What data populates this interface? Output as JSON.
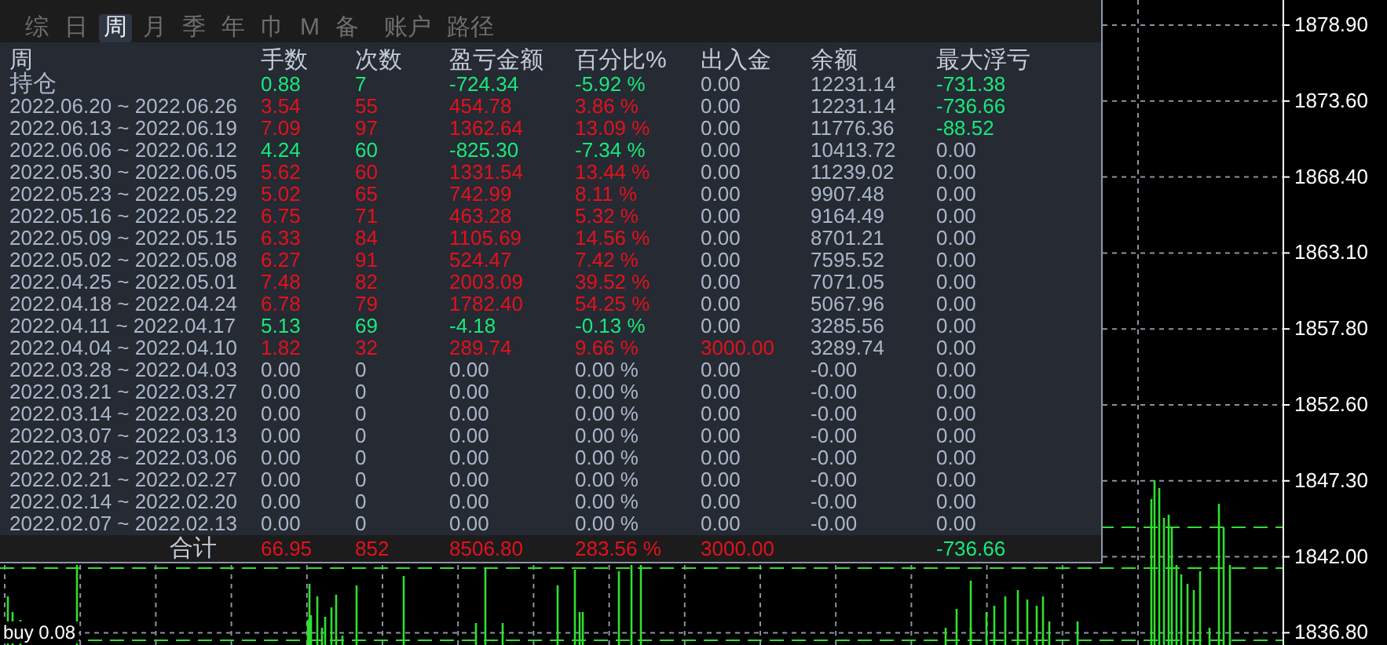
{
  "tabs": [
    {
      "label": "综",
      "selected": false
    },
    {
      "label": "日",
      "selected": false
    },
    {
      "label": "周",
      "selected": true
    },
    {
      "label": "月",
      "selected": false
    },
    {
      "label": "季",
      "selected": false
    },
    {
      "label": "年",
      "selected": false
    },
    {
      "label": "巾",
      "selected": false
    },
    {
      "label": "M",
      "selected": false
    },
    {
      "label": "备",
      "selected": false
    },
    {
      "label": "账户",
      "selected": false
    },
    {
      "label": "路径",
      "selected": false
    }
  ],
  "table": {
    "columns": [
      "周",
      "手数",
      "次数",
      "盈亏金额",
      "百分比%",
      "出入金",
      "余额",
      "最大浮亏"
    ],
    "rows": [
      [
        {
          "text": "持仓",
          "color": "#aab6c8"
        },
        {
          "text": "0.88",
          "color": "#19e87a"
        },
        {
          "text": "7",
          "color": "#19e87a"
        },
        {
          "text": "-724.34",
          "color": "#19e87a"
        },
        {
          "text": "-5.92 %",
          "color": "#19e87a"
        },
        {
          "text": "0.00",
          "color": "#aab6c8"
        },
        {
          "text": "12231.14",
          "color": "#aab6c8"
        },
        {
          "text": "-731.38",
          "color": "#19e87a"
        }
      ],
      [
        {
          "text": "2022.06.20 ~ 2022.06.26",
          "color": "#aab6c8"
        },
        {
          "text": "3.54",
          "color": "#e3121c"
        },
        {
          "text": "55",
          "color": "#e3121c"
        },
        {
          "text": "454.78",
          "color": "#e3121c"
        },
        {
          "text": "3.86 %",
          "color": "#e3121c"
        },
        {
          "text": "0.00",
          "color": "#aab6c8"
        },
        {
          "text": "12231.14",
          "color": "#aab6c8"
        },
        {
          "text": "-736.66",
          "color": "#19e87a"
        }
      ],
      [
        {
          "text": "2022.06.13 ~ 2022.06.19",
          "color": "#aab6c8"
        },
        {
          "text": "7.09",
          "color": "#e3121c"
        },
        {
          "text": "97",
          "color": "#e3121c"
        },
        {
          "text": "1362.64",
          "color": "#e3121c"
        },
        {
          "text": "13.09 %",
          "color": "#e3121c"
        },
        {
          "text": "0.00",
          "color": "#aab6c8"
        },
        {
          "text": "11776.36",
          "color": "#aab6c8"
        },
        {
          "text": "-88.52",
          "color": "#19e87a"
        }
      ],
      [
        {
          "text": "2022.06.06 ~ 2022.06.12",
          "color": "#aab6c8"
        },
        {
          "text": "4.24",
          "color": "#19e87a"
        },
        {
          "text": "60",
          "color": "#19e87a"
        },
        {
          "text": "-825.30",
          "color": "#19e87a"
        },
        {
          "text": "-7.34 %",
          "color": "#19e87a"
        },
        {
          "text": "0.00",
          "color": "#aab6c8"
        },
        {
          "text": "10413.72",
          "color": "#aab6c8"
        },
        {
          "text": "0.00",
          "color": "#aab6c8"
        }
      ],
      [
        {
          "text": "2022.05.30 ~ 2022.06.05",
          "color": "#aab6c8"
        },
        {
          "text": "5.62",
          "color": "#e3121c"
        },
        {
          "text": "60",
          "color": "#e3121c"
        },
        {
          "text": "1331.54",
          "color": "#e3121c"
        },
        {
          "text": "13.44 %",
          "color": "#e3121c"
        },
        {
          "text": "0.00",
          "color": "#aab6c8"
        },
        {
          "text": "11239.02",
          "color": "#aab6c8"
        },
        {
          "text": "0.00",
          "color": "#aab6c8"
        }
      ],
      [
        {
          "text": "2022.05.23 ~ 2022.05.29",
          "color": "#aab6c8"
        },
        {
          "text": "5.02",
          "color": "#e3121c"
        },
        {
          "text": "65",
          "color": "#e3121c"
        },
        {
          "text": "742.99",
          "color": "#e3121c"
        },
        {
          "text": "8.11 %",
          "color": "#e3121c"
        },
        {
          "text": "0.00",
          "color": "#aab6c8"
        },
        {
          "text": "9907.48",
          "color": "#aab6c8"
        },
        {
          "text": "0.00",
          "color": "#aab6c8"
        }
      ],
      [
        {
          "text": "2022.05.16 ~ 2022.05.22",
          "color": "#aab6c8"
        },
        {
          "text": "6.75",
          "color": "#e3121c"
        },
        {
          "text": "71",
          "color": "#e3121c"
        },
        {
          "text": "463.28",
          "color": "#e3121c"
        },
        {
          "text": "5.32 %",
          "color": "#e3121c"
        },
        {
          "text": "0.00",
          "color": "#aab6c8"
        },
        {
          "text": "9164.49",
          "color": "#aab6c8"
        },
        {
          "text": "0.00",
          "color": "#aab6c8"
        }
      ],
      [
        {
          "text": "2022.05.09 ~ 2022.05.15",
          "color": "#aab6c8"
        },
        {
          "text": "6.33",
          "color": "#e3121c"
        },
        {
          "text": "84",
          "color": "#e3121c"
        },
        {
          "text": "1105.69",
          "color": "#e3121c"
        },
        {
          "text": "14.56 %",
          "color": "#e3121c"
        },
        {
          "text": "0.00",
          "color": "#aab6c8"
        },
        {
          "text": "8701.21",
          "color": "#aab6c8"
        },
        {
          "text": "0.00",
          "color": "#aab6c8"
        }
      ],
      [
        {
          "text": "2022.05.02 ~ 2022.05.08",
          "color": "#aab6c8"
        },
        {
          "text": "6.27",
          "color": "#e3121c"
        },
        {
          "text": "91",
          "color": "#e3121c"
        },
        {
          "text": "524.47",
          "color": "#e3121c"
        },
        {
          "text": "7.42 %",
          "color": "#e3121c"
        },
        {
          "text": "0.00",
          "color": "#aab6c8"
        },
        {
          "text": "7595.52",
          "color": "#aab6c8"
        },
        {
          "text": "0.00",
          "color": "#aab6c8"
        }
      ],
      [
        {
          "text": "2022.04.25 ~ 2022.05.01",
          "color": "#aab6c8"
        },
        {
          "text": "7.48",
          "color": "#e3121c"
        },
        {
          "text": "82",
          "color": "#e3121c"
        },
        {
          "text": "2003.09",
          "color": "#e3121c"
        },
        {
          "text": "39.52 %",
          "color": "#e3121c"
        },
        {
          "text": "0.00",
          "color": "#aab6c8"
        },
        {
          "text": "7071.05",
          "color": "#aab6c8"
        },
        {
          "text": "0.00",
          "color": "#aab6c8"
        }
      ],
      [
        {
          "text": "2022.04.18 ~ 2022.04.24",
          "color": "#aab6c8"
        },
        {
          "text": "6.78",
          "color": "#e3121c"
        },
        {
          "text": "79",
          "color": "#e3121c"
        },
        {
          "text": "1782.40",
          "color": "#e3121c"
        },
        {
          "text": "54.25 %",
          "color": "#e3121c"
        },
        {
          "text": "0.00",
          "color": "#aab6c8"
        },
        {
          "text": "5067.96",
          "color": "#aab6c8"
        },
        {
          "text": "0.00",
          "color": "#aab6c8"
        }
      ],
      [
        {
          "text": "2022.04.11 ~ 2022.04.17",
          "color": "#aab6c8"
        },
        {
          "text": "5.13",
          "color": "#19e87a"
        },
        {
          "text": "69",
          "color": "#19e87a"
        },
        {
          "text": "-4.18",
          "color": "#19e87a"
        },
        {
          "text": "-0.13 %",
          "color": "#19e87a"
        },
        {
          "text": "0.00",
          "color": "#aab6c8"
        },
        {
          "text": "3285.56",
          "color": "#aab6c8"
        },
        {
          "text": "0.00",
          "color": "#aab6c8"
        }
      ],
      [
        {
          "text": "2022.04.04 ~ 2022.04.10",
          "color": "#aab6c8"
        },
        {
          "text": "1.82",
          "color": "#e3121c"
        },
        {
          "text": "32",
          "color": "#e3121c"
        },
        {
          "text": "289.74",
          "color": "#e3121c"
        },
        {
          "text": "9.66 %",
          "color": "#e3121c"
        },
        {
          "text": "3000.00",
          "color": "#e3121c"
        },
        {
          "text": "3289.74",
          "color": "#aab6c8"
        },
        {
          "text": "0.00",
          "color": "#aab6c8"
        }
      ],
      [
        {
          "text": "2022.03.28 ~ 2022.04.03",
          "color": "#aab6c8"
        },
        {
          "text": "0.00",
          "color": "#aab6c8"
        },
        {
          "text": "0",
          "color": "#aab6c8"
        },
        {
          "text": "0.00",
          "color": "#aab6c8"
        },
        {
          "text": "0.00 %",
          "color": "#aab6c8"
        },
        {
          "text": "0.00",
          "color": "#aab6c8"
        },
        {
          "text": "-0.00",
          "color": "#aab6c8"
        },
        {
          "text": "0.00",
          "color": "#aab6c8"
        }
      ],
      [
        {
          "text": "2022.03.21 ~ 2022.03.27",
          "color": "#aab6c8"
        },
        {
          "text": "0.00",
          "color": "#aab6c8"
        },
        {
          "text": "0",
          "color": "#aab6c8"
        },
        {
          "text": "0.00",
          "color": "#aab6c8"
        },
        {
          "text": "0.00 %",
          "color": "#aab6c8"
        },
        {
          "text": "0.00",
          "color": "#aab6c8"
        },
        {
          "text": "-0.00",
          "color": "#aab6c8"
        },
        {
          "text": "0.00",
          "color": "#aab6c8"
        }
      ],
      [
        {
          "text": "2022.03.14 ~ 2022.03.20",
          "color": "#aab6c8"
        },
        {
          "text": "0.00",
          "color": "#aab6c8"
        },
        {
          "text": "0",
          "color": "#aab6c8"
        },
        {
          "text": "0.00",
          "color": "#aab6c8"
        },
        {
          "text": "0.00 %",
          "color": "#aab6c8"
        },
        {
          "text": "0.00",
          "color": "#aab6c8"
        },
        {
          "text": "-0.00",
          "color": "#aab6c8"
        },
        {
          "text": "0.00",
          "color": "#aab6c8"
        }
      ],
      [
        {
          "text": "2022.03.07 ~ 2022.03.13",
          "color": "#aab6c8"
        },
        {
          "text": "0.00",
          "color": "#aab6c8"
        },
        {
          "text": "0",
          "color": "#aab6c8"
        },
        {
          "text": "0.00",
          "color": "#aab6c8"
        },
        {
          "text": "0.00 %",
          "color": "#aab6c8"
        },
        {
          "text": "0.00",
          "color": "#aab6c8"
        },
        {
          "text": "-0.00",
          "color": "#aab6c8"
        },
        {
          "text": "0.00",
          "color": "#aab6c8"
        }
      ],
      [
        {
          "text": "2022.02.28 ~ 2022.03.06",
          "color": "#aab6c8"
        },
        {
          "text": "0.00",
          "color": "#aab6c8"
        },
        {
          "text": "0",
          "color": "#aab6c8"
        },
        {
          "text": "0.00",
          "color": "#aab6c8"
        },
        {
          "text": "0.00 %",
          "color": "#aab6c8"
        },
        {
          "text": "0.00",
          "color": "#aab6c8"
        },
        {
          "text": "-0.00",
          "color": "#aab6c8"
        },
        {
          "text": "0.00",
          "color": "#aab6c8"
        }
      ],
      [
        {
          "text": "2022.02.21 ~ 2022.02.27",
          "color": "#aab6c8"
        },
        {
          "text": "0.00",
          "color": "#aab6c8"
        },
        {
          "text": "0",
          "color": "#aab6c8"
        },
        {
          "text": "0.00",
          "color": "#aab6c8"
        },
        {
          "text": "0.00 %",
          "color": "#aab6c8"
        },
        {
          "text": "0.00",
          "color": "#aab6c8"
        },
        {
          "text": "-0.00",
          "color": "#aab6c8"
        },
        {
          "text": "0.00",
          "color": "#aab6c8"
        }
      ],
      [
        {
          "text": "2022.02.14 ~ 2022.02.20",
          "color": "#aab6c8"
        },
        {
          "text": "0.00",
          "color": "#aab6c8"
        },
        {
          "text": "0",
          "color": "#aab6c8"
        },
        {
          "text": "0.00",
          "color": "#aab6c8"
        },
        {
          "text": "0.00 %",
          "color": "#aab6c8"
        },
        {
          "text": "0.00",
          "color": "#aab6c8"
        },
        {
          "text": "-0.00",
          "color": "#aab6c8"
        },
        {
          "text": "0.00",
          "color": "#aab6c8"
        }
      ],
      [
        {
          "text": "2022.02.07 ~ 2022.02.13",
          "color": "#aab6c8"
        },
        {
          "text": "0.00",
          "color": "#aab6c8"
        },
        {
          "text": "0",
          "color": "#aab6c8"
        },
        {
          "text": "0.00",
          "color": "#aab6c8"
        },
        {
          "text": "0.00 %",
          "color": "#aab6c8"
        },
        {
          "text": "0.00",
          "color": "#aab6c8"
        },
        {
          "text": "-0.00",
          "color": "#aab6c8"
        },
        {
          "text": "0.00",
          "color": "#aab6c8"
        }
      ]
    ],
    "footer": [
      {
        "text": "合计",
        "color": "#c4ccd8"
      },
      {
        "text": "66.95",
        "color": "#e3121c"
      },
      {
        "text": "852",
        "color": "#e3121c"
      },
      {
        "text": "8506.80",
        "color": "#e3121c"
      },
      {
        "text": "283.56 %",
        "color": "#e3121c"
      },
      {
        "text": "3000.00",
        "color": "#e3121c"
      },
      {
        "text": "-736.66",
        "color": "#19e87a",
        "gap_before": true
      }
    ]
  },
  "chart": {
    "price_labels": [
      "1878.90",
      "1873.60",
      "1868.40",
      "1863.10",
      "1857.80",
      "1852.60",
      "1847.30",
      "1842.00",
      "1836.80"
    ],
    "trade_label": "buy 0.08"
  }
}
